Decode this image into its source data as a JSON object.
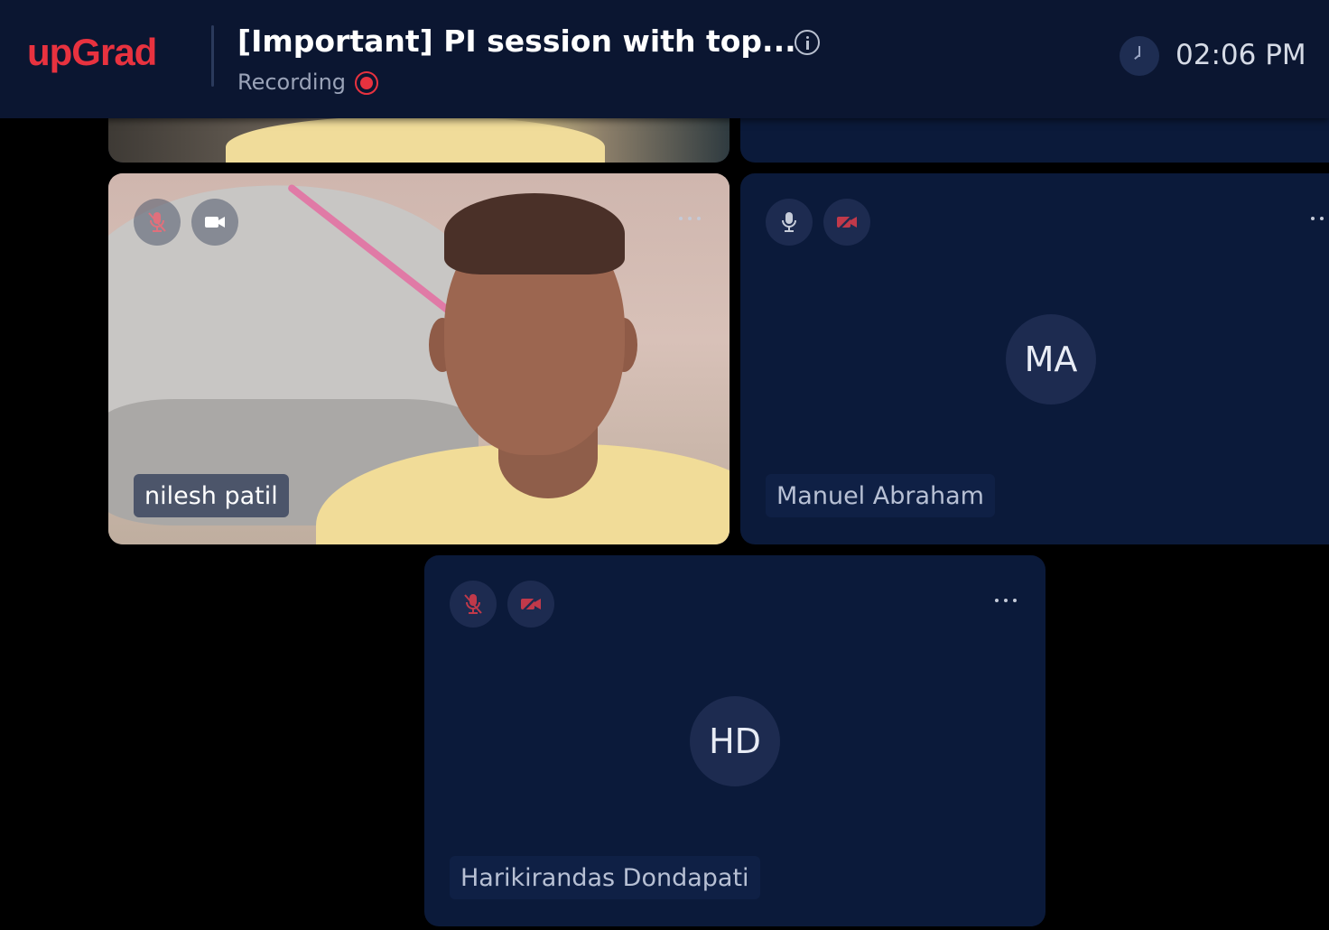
{
  "header": {
    "logo": "upGrad",
    "session_title": "[Important] PI session with top...",
    "recording_label": "Recording",
    "time": "02:06 PM",
    "icons": [
      "info-icon",
      "recording-icon",
      "clock-icon"
    ]
  },
  "participants": [
    {
      "name": "nilesh patil",
      "video": "on",
      "mic": "off",
      "camera": "on"
    },
    {
      "name": "Manuel Abraham",
      "initials": "MA",
      "video": "off",
      "mic": "on",
      "camera": "off"
    },
    {
      "name": "Harikirandas Dondapati",
      "initials": "HD",
      "video": "off",
      "mic": "off",
      "camera": "off"
    }
  ],
  "colors": {
    "brand": "#e8323f",
    "header_bg": "#0b1631",
    "tile_bg": "#0b1a3a",
    "muted_red": "#c0394a"
  }
}
